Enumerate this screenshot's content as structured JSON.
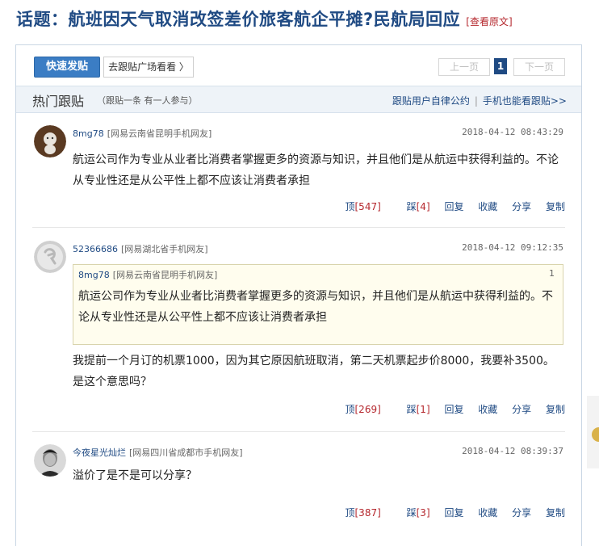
{
  "topic": {
    "title": "话题：航班因天气取消改签差价旅客航企平摊?民航局回应",
    "link": "[查看原文]"
  },
  "toolbar": {
    "quick_post": "快速发贴",
    "plaza": "去跟贴广场看看 〉",
    "prev": "上一页",
    "page": "1",
    "next": "下一页"
  },
  "hot": {
    "title": "热门跟贴",
    "sub": "（跟贴一条  有一人参与）",
    "convention": "跟贴用户自律公约",
    "sep": "|",
    "mobile": "手机也能看跟贴>>"
  },
  "posts": [
    {
      "user": "8mg78",
      "location": "[网易云南省昆明手机网友]",
      "time": "2018-04-12 08:43:29",
      "text": "航运公司作为专业从业者比消费者掌握更多的资源与知识，并且他们是从航运中获得利益的。不论从专业性还是从公平性上都不应该让消费者承担",
      "up": "顶",
      "up_count": "[547]",
      "down": "踩",
      "down_count": "[4]",
      "reply": "回复",
      "fav": "收藏",
      "share": "分享",
      "copy": "复制"
    },
    {
      "user": "52366686",
      "location": "[网易湖北省手机网友]",
      "time": "2018-04-12 09:12:35",
      "quote": {
        "user": "8mg78",
        "location": "[网易云南省昆明手机网友]",
        "floor": "1",
        "text": "航运公司作为专业从业者比消费者掌握更多的资源与知识，并且他们是从航运中获得利益的。不论从专业性还是从公平性上都不应该让消费者承担"
      },
      "text": "我提前一个月订的机票1000，因为其它原因航班取消，第二天机票起步价8000，我要补3500。是这个意思吗？",
      "up": "顶",
      "up_count": "[269]",
      "down": "踩",
      "down_count": "[1]",
      "reply": "回复",
      "fav": "收藏",
      "share": "分享",
      "copy": "复制"
    },
    {
      "user": "今夜星光灿烂",
      "location": "[网易四川省成都市手机网友]",
      "time": "2018-04-12 08:39:37",
      "text": "溢价了是不是可以分享？",
      "up": "顶",
      "up_count": "[387]",
      "down": "踩",
      "down_count": "[3]",
      "reply": "回复",
      "fav": "收藏",
      "share": "分享",
      "copy": "复制"
    }
  ],
  "colors": {
    "link_blue": "#1f4a83",
    "button_blue": "#3b7dc4",
    "count_red": "#b5282e",
    "quote_bg": "#fffdee"
  }
}
